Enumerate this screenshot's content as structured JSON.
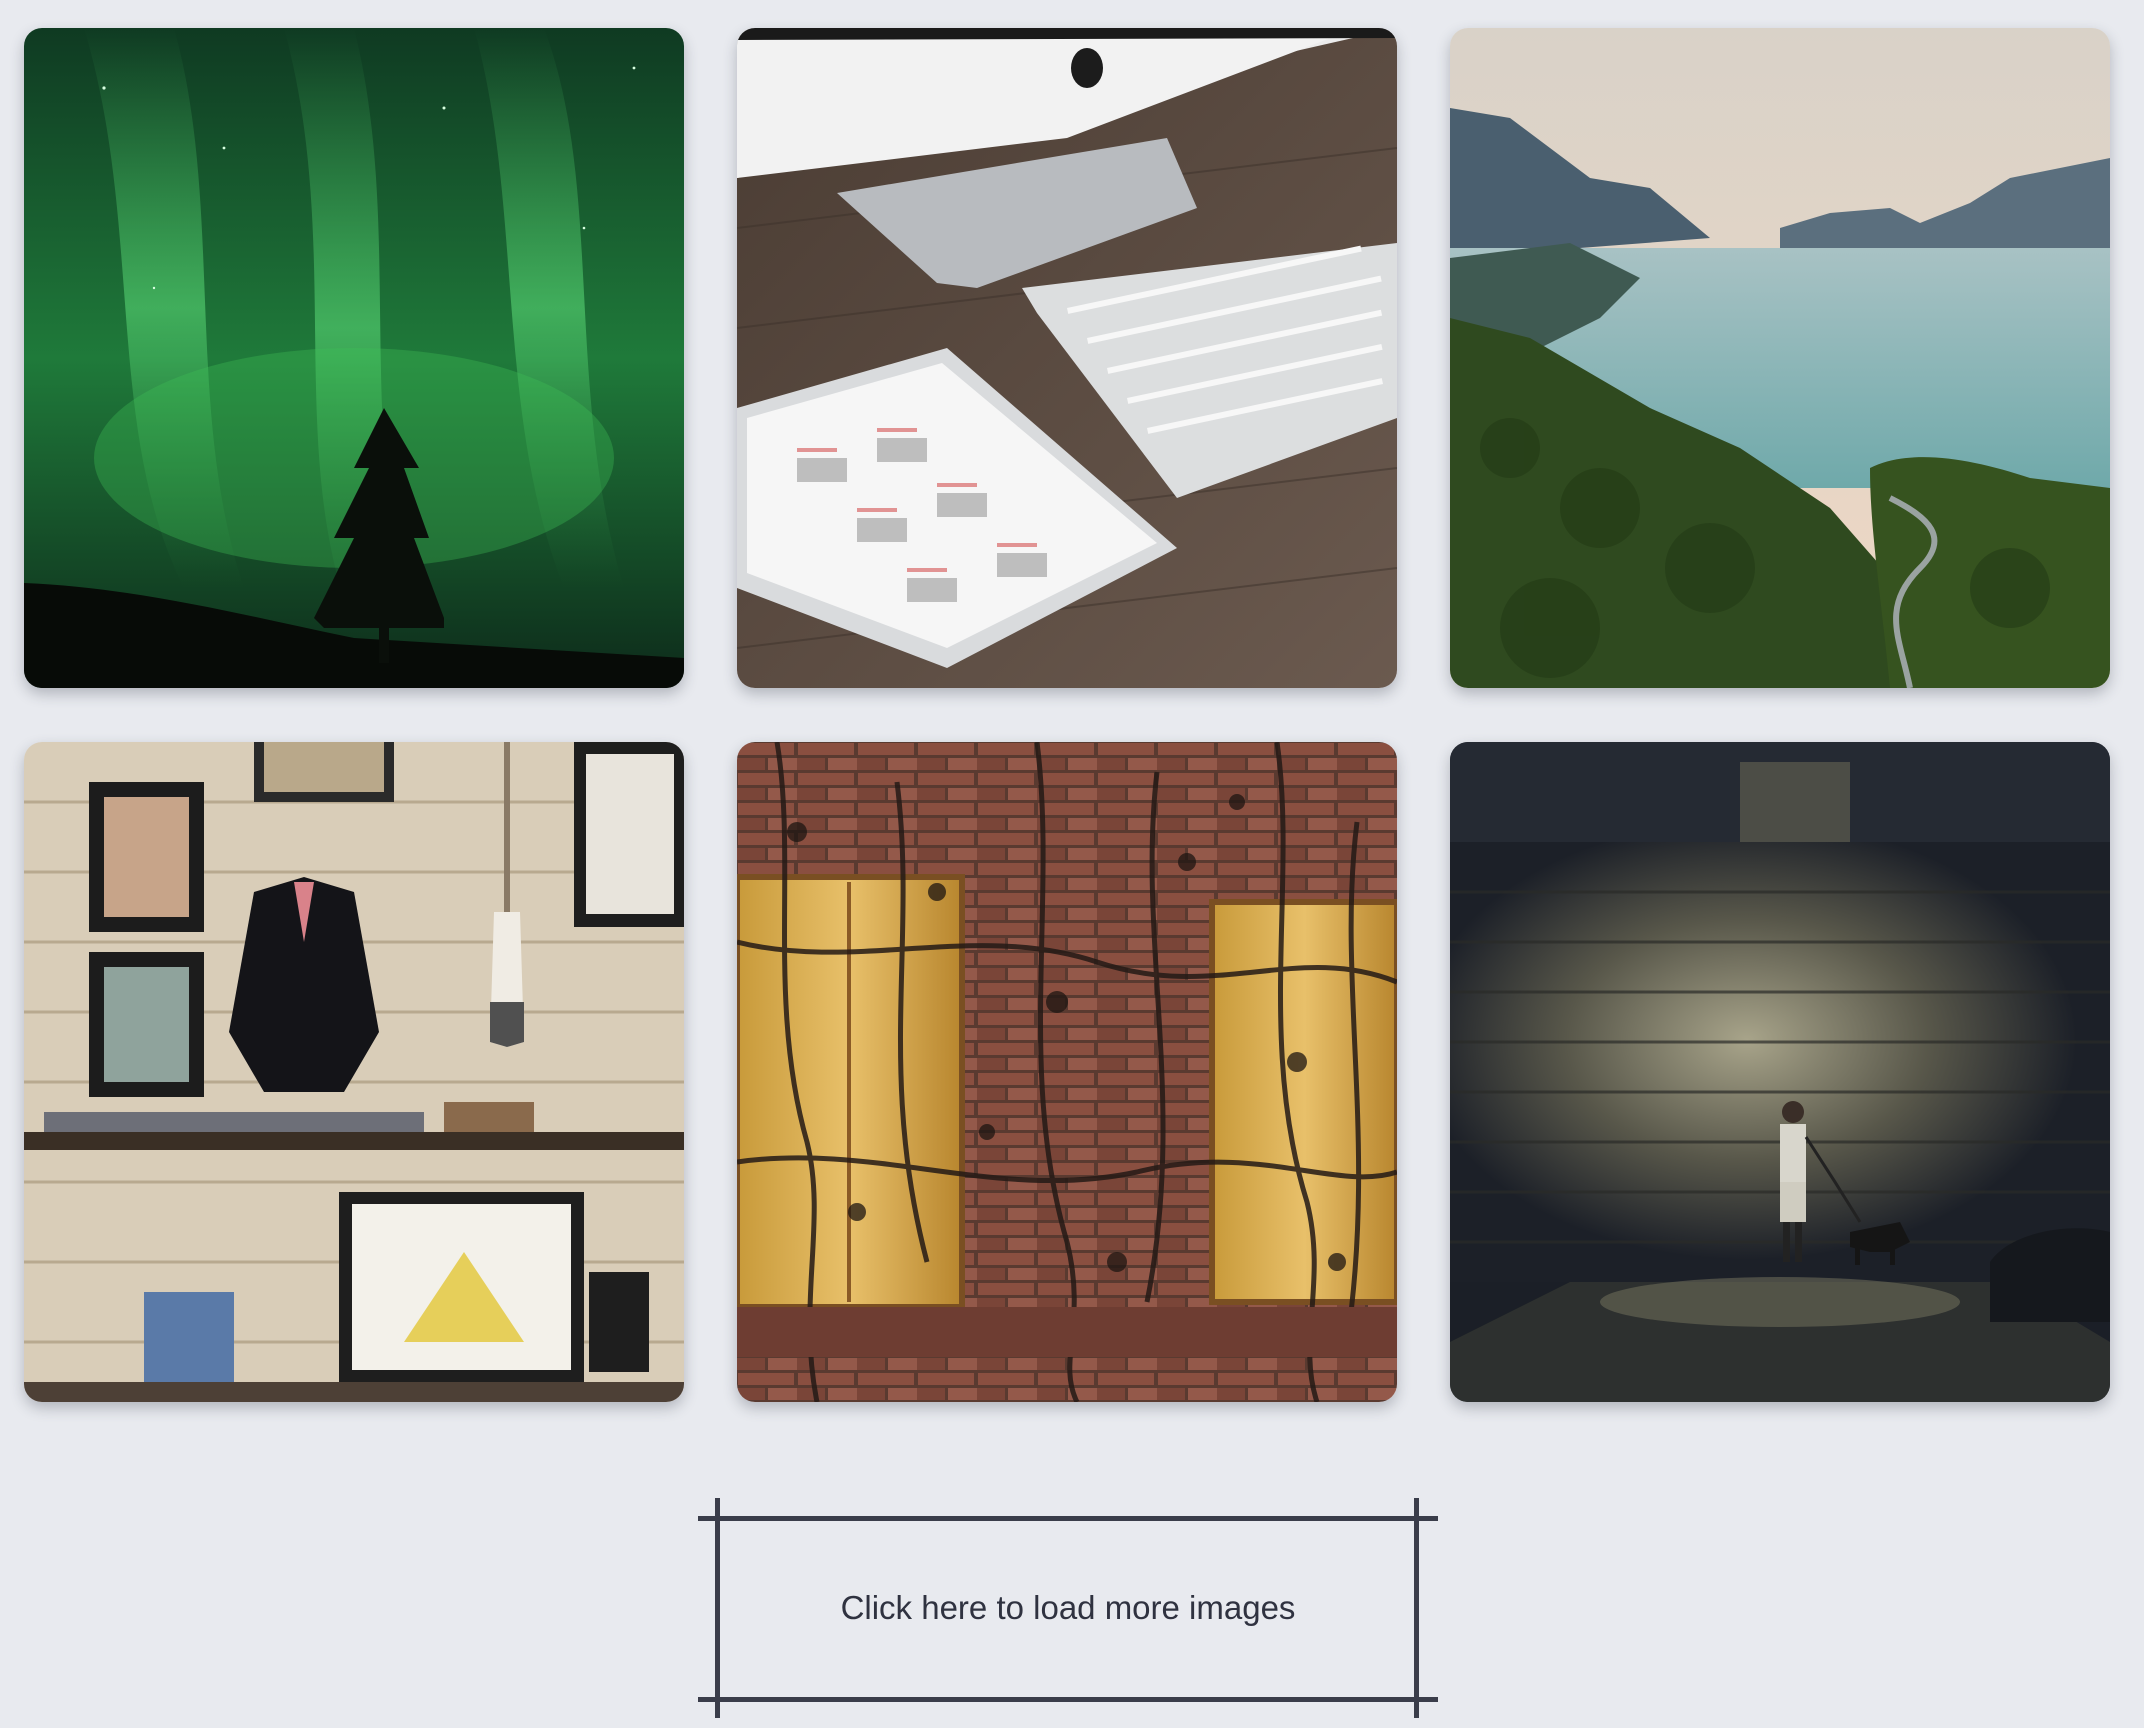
{
  "gallery": {
    "images": [
      {
        "subject": "Green aurora borealis above a silhouetted pine tree"
      },
      {
        "subject": "Desk with monitor, white keyboard and tablet showing a calendar"
      },
      {
        "subject": "Forested mountains beside a turquoise lake with a winding road"
      },
      {
        "subject": "Shop wall with framed pictures, a blazer on a hanger and a paddle"
      },
      {
        "subject": "Brick wall with two wooden shutters covered in dry vines"
      },
      {
        "subject": "Person walking a dog under a beam of light by a stone wall"
      }
    ]
  },
  "load_more": {
    "label": "Click here to load more images"
  },
  "colors": {
    "background": "#e8eaef",
    "frame": "#3a3d4a",
    "text": "#2f3240"
  }
}
